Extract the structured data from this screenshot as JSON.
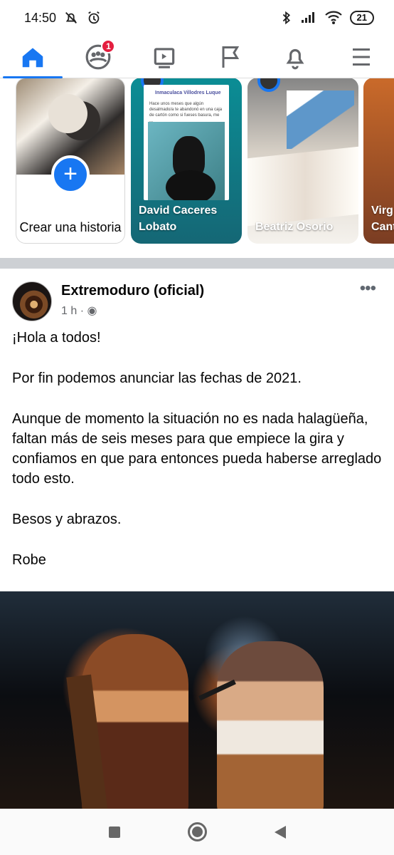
{
  "status": {
    "time": "14:50",
    "battery": "21"
  },
  "nav": {
    "notification_count": "1"
  },
  "stories": [
    {
      "label": "Crear una historia"
    },
    {
      "label": "David Caceres Lobato",
      "preview_author": "Inmaculaca Villodres Luque",
      "preview_text": "Hace unos meses que algún desalmado/a te abandonó en una caja de cartón como si fueses basura, me ..."
    },
    {
      "label": "Beatriz Osorio"
    },
    {
      "label": "Virg Cant"
    }
  ],
  "post": {
    "page_name": "Extremoduro (oficial)",
    "time": "1 h",
    "paragraphs": [
      "¡Hola a todos!",
      "Por fin podemos anunciar las fechas de 2021.",
      "Aunque de momento la situación no es nada halagüeña, faltan más de seis meses para que empiece la gira y confiamos en que para entonces pueda haberse arreglado todo esto.",
      "Besos y abrazos.",
      "Robe"
    ]
  },
  "icons": {
    "home": "home-icon",
    "groups": "groups-icon",
    "watch": "video-icon",
    "pages": "flag-icon",
    "notifications": "bell-icon",
    "menu": "menu-icon"
  },
  "colors": {
    "facebook_blue": "#1877f2",
    "badge_red": "#e41e3f"
  }
}
